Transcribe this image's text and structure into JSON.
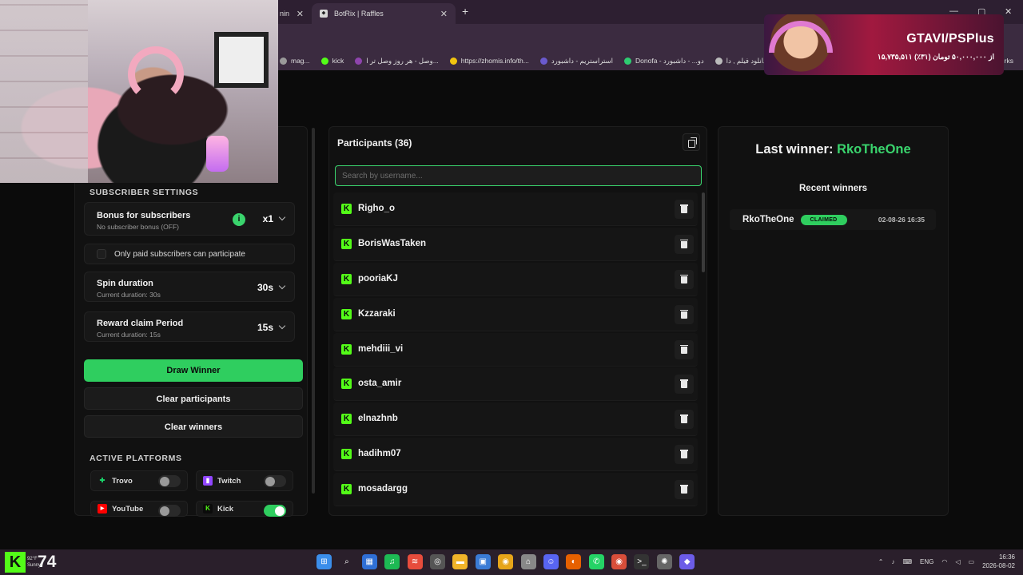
{
  "browser": {
    "tabs": [
      {
        "title": "nin",
        "close": "✕"
      },
      {
        "title": "BotRix | Raffles",
        "close": "✕"
      }
    ],
    "new_tab": "+",
    "window_controls": {
      "minimize": "—",
      "maximize": "▢",
      "close": "✕"
    },
    "bookmarks": [
      {
        "label": "mag...",
        "color": "#9a9a9a"
      },
      {
        "label": "kick",
        "color": "#53fc18"
      },
      {
        "label": "وصل - هر روز وصل تر ا...",
        "color": "#8e44ad"
      },
      {
        "label": "https://zhomis.info/th...",
        "color": "#f1c40f"
      },
      {
        "label": "استراستریم - داشبورد",
        "color": "#6a5acd"
      },
      {
        "label": "Donofa - دو... - داشبورد",
        "color": "#2ecc71"
      },
      {
        "label": "دانلود فیلم , دا...",
        "color": "#bbbbbb"
      }
    ],
    "bookmarks_more": "rks"
  },
  "banner": {
    "title": "GTAVI/PSPlus",
    "subtitle": "۱۵,۷۳۵,۵۱۱ از ۵۰,۰۰۰,۰۰۰ تومان (۳۱٪)"
  },
  "left": {
    "info_icon": "i",
    "subscriber_settings_title": "SUBSCRIBER SETTINGS",
    "bonus": {
      "title": "Bonus for subscribers",
      "subtitle": "No subscriber bonus (OFF)",
      "value": "x1",
      "info": "i"
    },
    "only_paid": "Only paid subscribers can participate",
    "spin": {
      "title": "Spin duration",
      "subtitle": "Current duration: 30s",
      "value": "30s"
    },
    "reward": {
      "title": "Reward claim Period",
      "subtitle": "Current duration: 15s",
      "value": "15s"
    },
    "draw_winner": "Draw Winner",
    "clear_participants": "Clear participants",
    "clear_winners": "Clear winners",
    "active_platforms_title": "ACTIVE PLATFORMS",
    "platforms": [
      {
        "name": "Trovo",
        "icon": "trovo-icon",
        "color": "#19d66b",
        "glyph": "✚",
        "enabled": false
      },
      {
        "name": "Twitch",
        "icon": "twitch-icon",
        "color": "#9146ff",
        "glyph": "▮",
        "enabled": false
      },
      {
        "name": "YouTube",
        "icon": "youtube-icon",
        "color": "#ff0000",
        "glyph": "▶",
        "enabled": false
      },
      {
        "name": "Kick",
        "icon": "kick-icon",
        "color": "#53fc18",
        "glyph": "K",
        "enabled": true
      }
    ]
  },
  "participants": {
    "title": "Participants (36)",
    "search_placeholder": "Search by username...",
    "kick_glyph": "K",
    "items": [
      "Righo_o",
      "BorisWasTaken",
      "pooriaKJ",
      "Kzzaraki",
      "mehdiii_vi",
      "osta_amir",
      "elnazhnb",
      "hadihm07",
      "mosadargg"
    ]
  },
  "winners": {
    "last_winner_label": "Last winner:",
    "last_winner_name": "RkoTheOne",
    "recent_title": "Recent winners",
    "recent": [
      {
        "name": "RkoTheOne",
        "status": "CLAIMED",
        "time": "02-08-26 16:35"
      }
    ]
  },
  "taskbar": {
    "weather": {
      "logo": "K",
      "temp": "92°F",
      "condition": "Sunny",
      "number": "74"
    },
    "icons": [
      {
        "name": "start-icon",
        "color": "#3b8eea",
        "glyph": "⊞"
      },
      {
        "name": "search-icon",
        "color": "transparent",
        "glyph": "⌕"
      },
      {
        "name": "widgets-icon",
        "color": "#2f6fd6",
        "glyph": "▦"
      },
      {
        "name": "spotify-icon",
        "color": "#1db954",
        "glyph": "♫"
      },
      {
        "name": "app-red-icon",
        "color": "#e74c3c",
        "glyph": "≋"
      },
      {
        "name": "app-shield-icon",
        "color": "#555",
        "glyph": "◎"
      },
      {
        "name": "folder-icon",
        "color": "#f0b429",
        "glyph": "▬"
      },
      {
        "name": "app-blue-icon",
        "color": "#3a7bd5",
        "glyph": "▣"
      },
      {
        "name": "chrome-icon",
        "color": "#e6a519",
        "glyph": "◉"
      },
      {
        "name": "app-lock-icon",
        "color": "#888",
        "glyph": "⌂"
      },
      {
        "name": "discord-icon",
        "color": "#5865f2",
        "glyph": "☺"
      },
      {
        "name": "firefox-icon",
        "color": "#e66000",
        "glyph": "◐"
      },
      {
        "name": "whatsapp-icon",
        "color": "#25d366",
        "glyph": "✆"
      },
      {
        "name": "chrome-active-icon",
        "color": "#d84e3a",
        "glyph": "◉"
      },
      {
        "name": "terminal-icon",
        "color": "#333",
        "glyph": ">_"
      },
      {
        "name": "app-gear-icon",
        "color": "#666",
        "glyph": "✺"
      },
      {
        "name": "app-diamond-icon",
        "color": "#6c5ce7",
        "glyph": "◆"
      }
    ],
    "tray": {
      "lang": "ENG",
      "time": "16:36",
      "date": "2026-08-02"
    }
  }
}
